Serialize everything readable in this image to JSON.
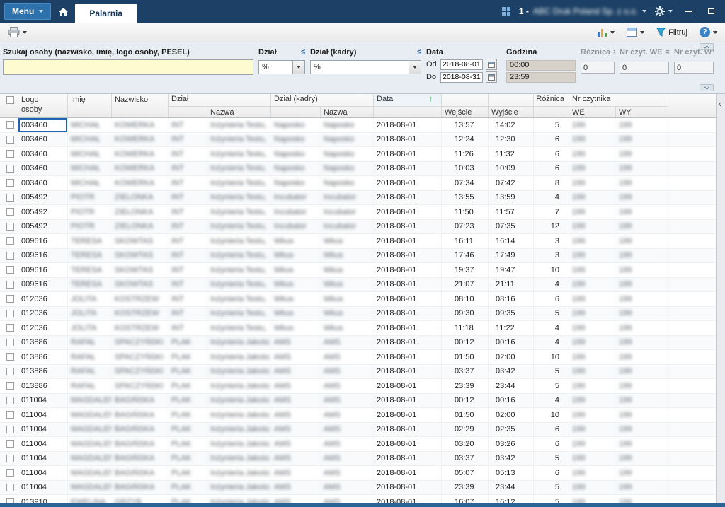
{
  "titlebar": {
    "menu_label": "Menu",
    "tab_label": "Palarnia",
    "company_prefix": "1 -",
    "company_name": "ABC Druk Poland Sp. z o.o."
  },
  "toolbar": {
    "filter_label": "Filtruj"
  },
  "icons": {
    "help": "?"
  },
  "filters": {
    "search_label": "Szukaj osoby (nazwisko, imię, logo osoby, PESEL)",
    "search_value": "",
    "dzial_label": "Dział",
    "dzial_operator": "≤",
    "dzial_value": "%",
    "kadry_label": "Dział (kadry)",
    "kadry_operator": "≤",
    "kadry_value": "%",
    "data_label": "Data",
    "od_label": "Od",
    "od_value": "2018-08-01",
    "do_label": "Do",
    "do_value": "2018-08-31",
    "godzina_label": "Godzina",
    "godzina_od": "00:00",
    "godzina_do": "23:59",
    "roznica_label": "Różnica",
    "roznica_operator": "=",
    "roznica_value": "0",
    "czyt_we_label": "Nr czyt. WE",
    "czyt_we_operator": "=",
    "czyt_we_value": "0",
    "czyt_wy_label": "Nr czyt. WY",
    "czyt_wy_value": "0"
  },
  "table": {
    "header": {
      "logo": "Logo osoby",
      "imie": "Imię",
      "nazwisko": "Nazwisko",
      "dzial_group": "Dział",
      "dzial_nazwa": "Nazwa",
      "kadry_group": "Dział (kadry)",
      "kadry_nazwa": "Nazwa",
      "data": "Data",
      "sort_icon": "↑",
      "wejscie": "Wejście",
      "wyjscie": "Wyjście",
      "roznica": "Różnica",
      "nr_czytnika": "Nr czytnika",
      "we": "WE",
      "wy": "WY"
    },
    "columns": [
      {
        "key": "logo",
        "blur": false
      },
      {
        "key": "imie",
        "blur": true
      },
      {
        "key": "nazwisko",
        "blur": true
      },
      {
        "key": "dzial_kod",
        "blur": true
      },
      {
        "key": "dzial_nazwa",
        "blur": true
      },
      {
        "key": "kadry_kod",
        "blur": true
      },
      {
        "key": "kadry_nazwa",
        "blur": true
      },
      {
        "key": "data",
        "blur": false
      },
      {
        "key": "wejscie",
        "blur": false
      },
      {
        "key": "wyjscie",
        "blur": false
      },
      {
        "key": "roznica",
        "blur": false
      },
      {
        "key": "we",
        "blur": true
      },
      {
        "key": "wy",
        "blur": true
      }
    ],
    "rows": [
      [
        "003460",
        "MICHAŁ",
        "KOWERKA",
        "INT",
        "Inżynieria Testu,",
        "Naposko",
        "Naposko",
        "2018-08-01",
        "13:57",
        "14:02",
        "5",
        "199",
        "199"
      ],
      [
        "003460",
        "MICHAŁ",
        "KOWERKA",
        "INT",
        "Inżynieria Testu,",
        "Naposko",
        "Naposko",
        "2018-08-01",
        "12:24",
        "12:30",
        "6",
        "199",
        "199"
      ],
      [
        "003460",
        "MICHAŁ",
        "KOWERKA",
        "INT",
        "Inżynieria Testu,",
        "Naposko",
        "Naposko",
        "2018-08-01",
        "11:26",
        "11:32",
        "6",
        "199",
        "199"
      ],
      [
        "003460",
        "MICHAŁ",
        "KOWERKA",
        "INT",
        "Inżynieria Testu,",
        "Naposko",
        "Naposko",
        "2018-08-01",
        "10:03",
        "10:09",
        "6",
        "199",
        "199"
      ],
      [
        "003460",
        "MICHAŁ",
        "KOWERKA",
        "INT",
        "Inżynieria Testu,",
        "Naposko",
        "Naposko",
        "2018-08-01",
        "07:34",
        "07:42",
        "8",
        "199",
        "199"
      ],
      [
        "005492",
        "PIOTR",
        "ZIELONKA",
        "INT",
        "Inżynieria Testu,",
        "Incubator",
        "Incubator",
        "2018-08-01",
        "13:55",
        "13:59",
        "4",
        "199",
        "199"
      ],
      [
        "005492",
        "PIOTR",
        "ZIELONKA",
        "INT",
        "Inżynieria Testu,",
        "Incubator",
        "Incubator",
        "2018-08-01",
        "11:50",
        "11:57",
        "7",
        "199",
        "199"
      ],
      [
        "005492",
        "PIOTR",
        "ZIELONKA",
        "INT",
        "Inżynieria Testu,",
        "Incubator",
        "Incubator",
        "2018-08-01",
        "07:23",
        "07:35",
        "12",
        "199",
        "199"
      ],
      [
        "009616",
        "TERESA",
        "SKOWTAS",
        "INT",
        "Inżynieria Testu,",
        "Wkus",
        "Wkus",
        "2018-08-01",
        "16:11",
        "16:14",
        "3",
        "199",
        "199"
      ],
      [
        "009616",
        "TERESA",
        "SKOWTAS",
        "INT",
        "Inżynieria Testu,",
        "Wkus",
        "Wkus",
        "2018-08-01",
        "17:46",
        "17:49",
        "3",
        "199",
        "199"
      ],
      [
        "009616",
        "TERESA",
        "SKOWTAS",
        "INT",
        "Inżynieria Testu,",
        "Wkus",
        "Wkus",
        "2018-08-01",
        "19:37",
        "19:47",
        "10",
        "199",
        "199"
      ],
      [
        "009616",
        "TERESA",
        "SKOWTAS",
        "INT",
        "Inżynieria Testu,",
        "Wkus",
        "Wkus",
        "2018-08-01",
        "21:07",
        "21:11",
        "4",
        "199",
        "199"
      ],
      [
        "012036",
        "JOLITA",
        "KOSTRZEW",
        "INT",
        "Inżynieria Testu,",
        "Wkus",
        "Wkus",
        "2018-08-01",
        "08:10",
        "08:16",
        "6",
        "199",
        "199"
      ],
      [
        "012036",
        "JOLITA",
        "KOSTRZEW",
        "INT",
        "Inżynieria Testu,",
        "Wkus",
        "Wkus",
        "2018-08-01",
        "09:30",
        "09:35",
        "5",
        "199",
        "199"
      ],
      [
        "012036",
        "JOLITA",
        "KOSTRZEW",
        "INT",
        "Inżynieria Testu,",
        "Wkus",
        "Wkus",
        "2018-08-01",
        "11:18",
        "11:22",
        "4",
        "199",
        "199"
      ],
      [
        "013886",
        "RAFAŁ",
        "SPACZYŃSKI",
        "PLAK",
        "Inżynieria Jakości",
        "AMS",
        "AMS",
        "2018-08-01",
        "00:12",
        "00:16",
        "4",
        "199",
        "199"
      ],
      [
        "013886",
        "RAFAŁ",
        "SPACZYŃSKI",
        "PLAK",
        "Inżynieria Jakości",
        "AMS",
        "AMS",
        "2018-08-01",
        "01:50",
        "02:00",
        "10",
        "199",
        "199"
      ],
      [
        "013886",
        "RAFAŁ",
        "SPACZYŃSKI",
        "PLAK",
        "Inżynieria Jakości",
        "AMS",
        "AMS",
        "2018-08-01",
        "03:37",
        "03:42",
        "5",
        "199",
        "199"
      ],
      [
        "013886",
        "RAFAŁ",
        "SPACZYŃSKI",
        "PLAK",
        "Inżynieria Jakości",
        "AMS",
        "AMS",
        "2018-08-01",
        "23:39",
        "23:44",
        "5",
        "199",
        "199"
      ],
      [
        "011004",
        "MAGDALENA",
        "BAGIŃSKA",
        "PLAK",
        "Inżynieria Jakości",
        "AMS",
        "AMS",
        "2018-08-01",
        "00:12",
        "00:16",
        "4",
        "199",
        "199"
      ],
      [
        "011004",
        "MAGDALENA",
        "BAGIŃSKA",
        "PLAK",
        "Inżynieria Jakości",
        "AMS",
        "AMS",
        "2018-08-01",
        "01:50",
        "02:00",
        "10",
        "199",
        "199"
      ],
      [
        "011004",
        "MAGDALENA",
        "BAGIŃSKA",
        "PLAK",
        "Inżynieria Jakości",
        "AMS",
        "AMS",
        "2018-08-01",
        "02:29",
        "02:35",
        "6",
        "199",
        "199"
      ],
      [
        "011004",
        "MAGDALENA",
        "BAGIŃSKA",
        "PLAK",
        "Inżynieria Jakości",
        "AMS",
        "AMS",
        "2018-08-01",
        "03:20",
        "03:26",
        "6",
        "199",
        "199"
      ],
      [
        "011004",
        "MAGDALENA",
        "BAGIŃSKA",
        "PLAK",
        "Inżynieria Jakości",
        "AMS",
        "AMS",
        "2018-08-01",
        "03:37",
        "03:42",
        "5",
        "199",
        "199"
      ],
      [
        "011004",
        "MAGDALENA",
        "BAGIŃSKA",
        "PLAK",
        "Inżynieria Jakości",
        "AMS",
        "AMS",
        "2018-08-01",
        "05:07",
        "05:13",
        "6",
        "199",
        "199"
      ],
      [
        "011004",
        "MAGDALENA",
        "BAGIŃSKA",
        "PLAK",
        "Inżynieria Jakości",
        "AMS",
        "AMS",
        "2018-08-01",
        "23:39",
        "23:44",
        "5",
        "199",
        "199"
      ],
      [
        "013910",
        "EWELINA",
        "GRZYB",
        "PLAK",
        "Inżynieria Jakości",
        "AMS",
        "AMS",
        "2018-08-01",
        "16:07",
        "16:12",
        "5",
        "199",
        "199"
      ]
    ]
  }
}
